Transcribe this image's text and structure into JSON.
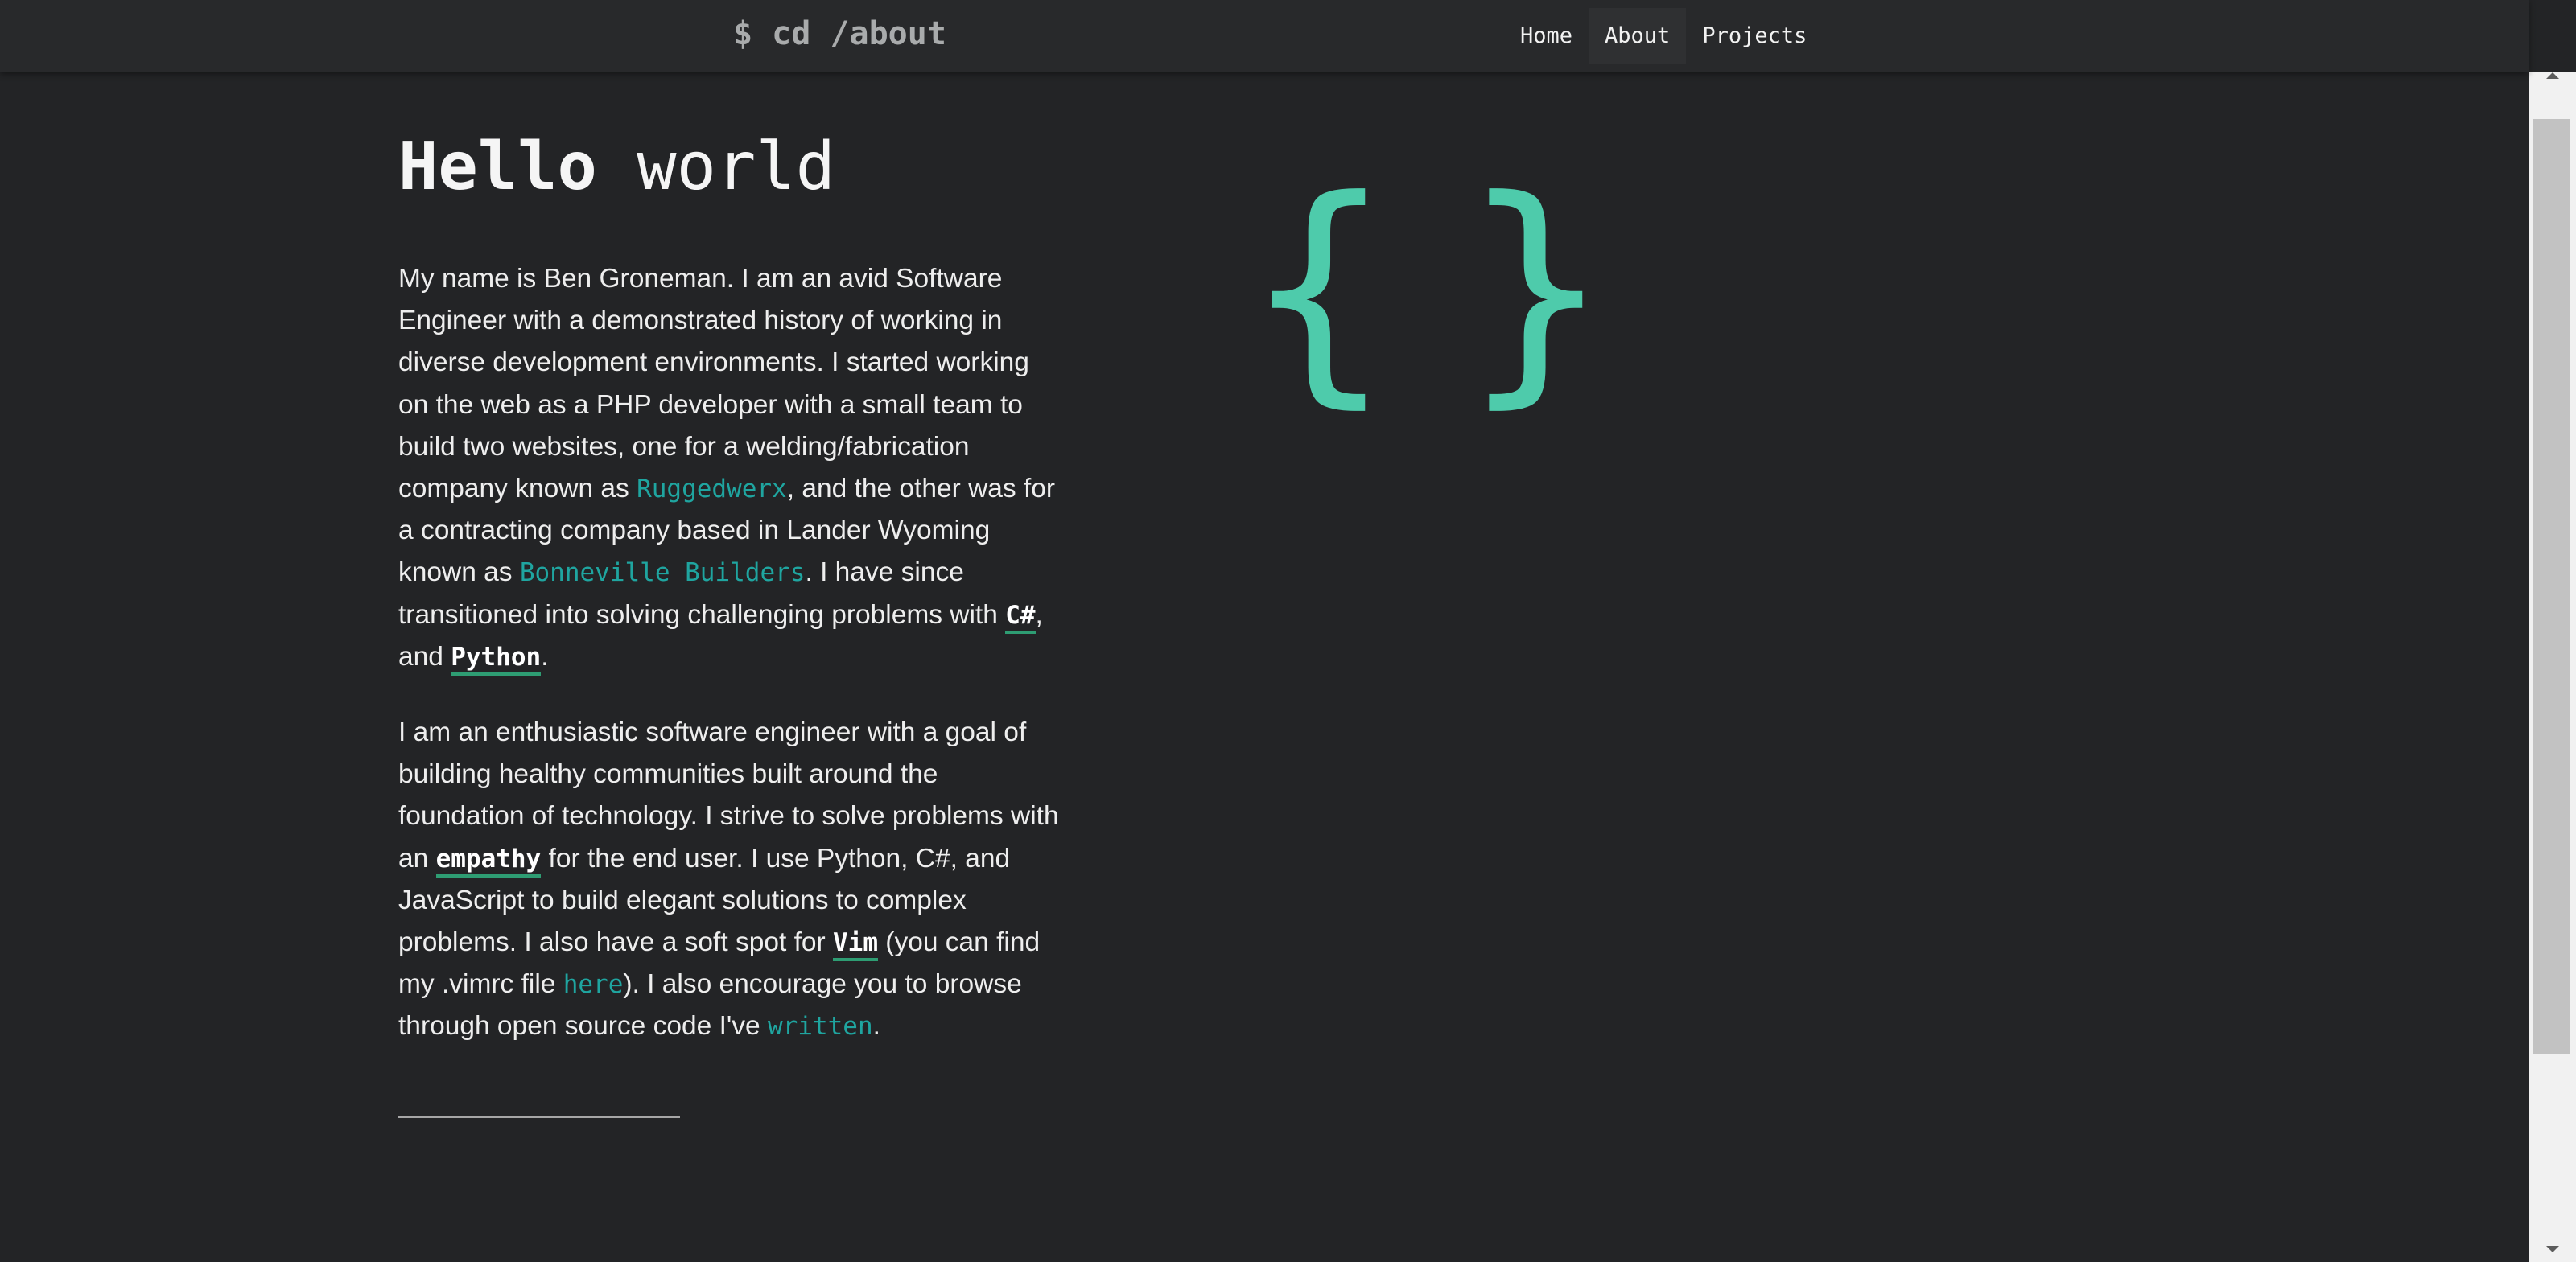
{
  "header": {
    "site_title": "$ cd /about",
    "nav": [
      {
        "label": "Home"
      },
      {
        "label": "About"
      },
      {
        "label": "Projects"
      }
    ]
  },
  "main": {
    "title_bold": "Hello",
    "title_rest": " world",
    "para1": {
      "t1": "My name is Ben Groneman. I am an avid Software Engineer with a demonstrated history of working in diverse development environments. I started working on the web as a PHP developer with a small team to build two websites, one for a welding/fabrication company known as ",
      "link1": "Ruggedwerx",
      "t2": ", and the other was for a contracting company based in Lander Wyoming known as ",
      "link2": "Bonneville Builders",
      "t3": ". I have since transitioned into solving challenging problems with ",
      "kw1": "C#",
      "t4": ", and ",
      "kw2": "Python",
      "t5": "."
    },
    "para2": {
      "t1": "I am an enthusiastic software engineer with a goal of building healthy communities built around the foundation of technology. I strive to solve problems with an ",
      "kw1": "empathy",
      "t2": " for the end user. I use Python, C#, and JavaScript to build elegant solutions to complex problems. I also have a soft spot for ",
      "kw2": "Vim",
      "t3": " (you can find my .vimrc file ",
      "link1": "here",
      "t4": "). I also encourage you to browse through open source code I've ",
      "link2": "written",
      "t5": "."
    }
  },
  "logo": {
    "icon": "curly-braces-icon",
    "left": "{",
    "right": "}",
    "color": "#4ecbab"
  },
  "colors": {
    "background": "#232426",
    "header": "#28292b",
    "link": "#1fa5a0",
    "keyword_underline": "#2e9d73"
  }
}
